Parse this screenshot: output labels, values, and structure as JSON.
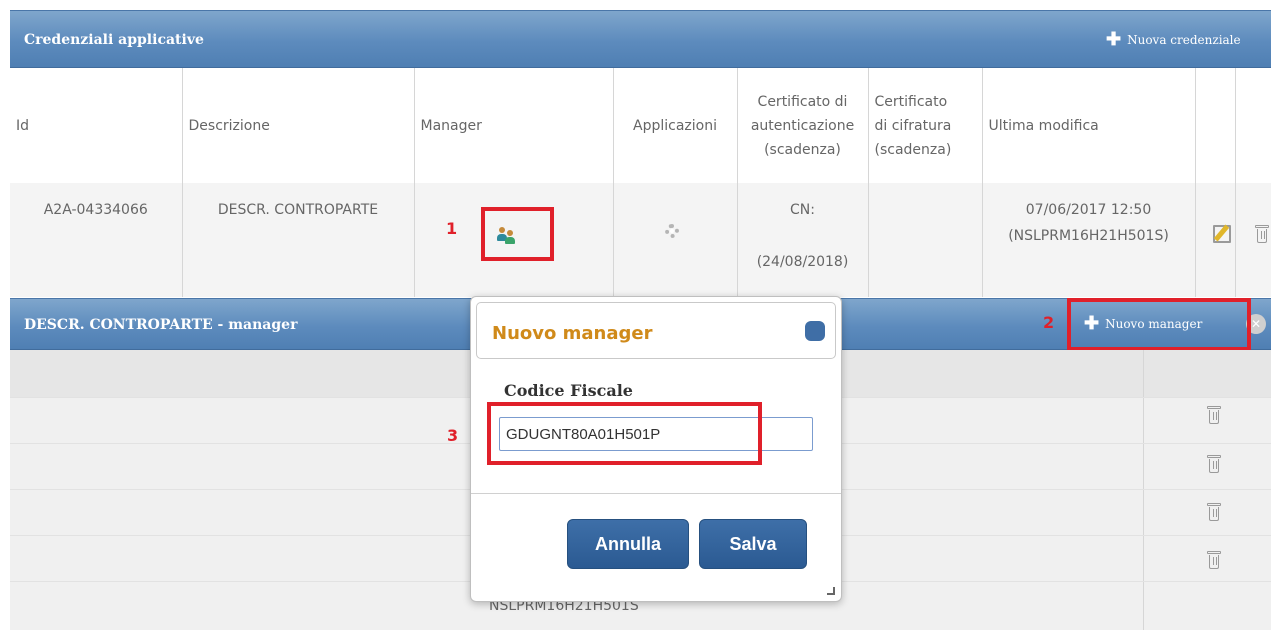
{
  "panel": {
    "title": "Credenziali applicative",
    "new_button": "Nuova credenziale"
  },
  "table": {
    "headers": {
      "id": "Id",
      "descrizione": "Descrizione",
      "manager": "Manager",
      "applicazioni": "Applicazioni",
      "cert_auth": [
        "Certificato di",
        "autenticazione",
        "(scadenza)"
      ],
      "cert_cifra": [
        "Certificato",
        "di cifratura",
        "(scadenza)"
      ],
      "ultima_modifica": "Ultima modifica"
    },
    "row": {
      "id": "A2A-04334066",
      "descrizione": "DESCR. CONTROPARTE",
      "cert_auth_cn": "CN:",
      "cert_auth_scadenza": "(24/08/2018)",
      "ultima_modifica_date": "07/06/2017 12:50",
      "ultima_modifica_user": "(NSLPRM16H21H501S)"
    }
  },
  "sub_panel": {
    "title": "DESCR. CONTROPARTE - manager",
    "new_button": "Nuovo manager",
    "last_row_text": "NSLPRM16H21H501S"
  },
  "steps": {
    "one": "1",
    "two": "2",
    "three": "3"
  },
  "dialog": {
    "title": "Nuovo manager",
    "field_label": "Codice Fiscale",
    "field_value": "GDUGNT80A01H501P",
    "cancel_label": "Annulla",
    "save_label": "Salva"
  },
  "colors": {
    "header_blue": "#5d8bbd",
    "highlight_red": "#e0202a",
    "dialog_title": "#d08a1a",
    "button_blue": "#2b5a92"
  },
  "icons": {
    "add": "plus-icon",
    "manager": "people-icon",
    "applications": "gear-icon",
    "edit": "edit-icon",
    "delete": "trash-icon",
    "close": "close-icon"
  }
}
